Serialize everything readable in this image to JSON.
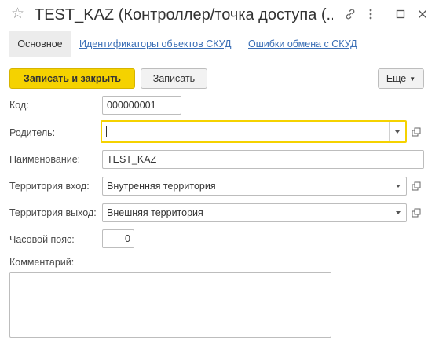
{
  "window": {
    "title": "TEST_KAZ (Контроллер/точка доступа (..."
  },
  "icons": {
    "favorite": "star-icon",
    "link": "link-icon",
    "more": "more-options-icon",
    "maximize": "maximize-icon",
    "close": "close-icon",
    "open": "open-form-icon",
    "dropdown": "chevron-down-icon"
  },
  "tabs": [
    {
      "label": "Основное",
      "active": true
    },
    {
      "label": "Идентификаторы объектов СКУД",
      "active": false
    },
    {
      "label": "Ошибки обмена с СКУД",
      "active": false
    }
  ],
  "toolbar": {
    "save_close_label": "Записать и закрыть",
    "save_label": "Записать",
    "more_label": "Еще"
  },
  "form": {
    "code": {
      "label": "Код:",
      "value": "000000001"
    },
    "parent": {
      "label": "Родитель:",
      "value": ""
    },
    "name": {
      "label": "Наименование:",
      "value": "TEST_KAZ"
    },
    "territory_in": {
      "label": "Территория вход:",
      "value": "Внутренняя территория"
    },
    "territory_out": {
      "label": "Территория выход:",
      "value": "Внешняя территория"
    },
    "timezone": {
      "label": "Часовой пояс:",
      "value": "0"
    },
    "comment": {
      "label": "Комментарий:",
      "value": ""
    }
  },
  "colors": {
    "accent": "#f5d200",
    "link": "#3b6fb6",
    "border": "#bdbdbd"
  }
}
